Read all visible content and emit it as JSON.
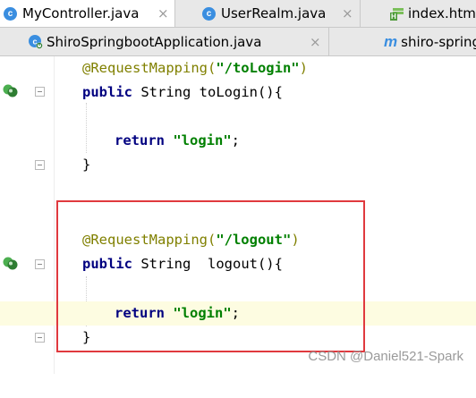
{
  "tabs_row1": [
    {
      "label": "MyController.java",
      "icon": "java-class-icon",
      "active": true,
      "closable": true
    },
    {
      "label": "UserRealm.java",
      "icon": "java-class-icon",
      "active": false,
      "closable": true
    },
    {
      "label": "index.html",
      "icon": "html-file-icon",
      "active": false,
      "closable": false
    }
  ],
  "tabs_row2": [
    {
      "label": "ShiroSpringbootApplication.java",
      "icon": "spring-boot-class-icon",
      "active": false,
      "closable": true
    },
    {
      "label": "shiro-springb",
      "icon": "maven-module-icon",
      "active": false,
      "closable": false
    }
  ],
  "icons": {
    "java_class_glyph": "c",
    "maven_glyph": "m",
    "html_badge": "H",
    "close_glyph": "×"
  },
  "editor": {
    "lines": {
      "l1": {
        "annotation": "@RequestMapping(",
        "string": "\"/toLogin\"",
        "close": ")"
      },
      "l2": {
        "kw": "public",
        "rest": " String toLogin(){"
      },
      "l3": {
        "kw": "return",
        "sp": " ",
        "string": "\"login\"",
        "end": ";"
      },
      "l4": {
        "text": "}"
      },
      "l5": {
        "annotation": "@RequestMapping(",
        "string": "\"/logout\"",
        "close": ")"
      },
      "l6": {
        "kw": "public",
        "rest": " String  logout(){"
      },
      "l7": {
        "kw": "return",
        "sp": " ",
        "string": "\"login\"",
        "end": ";"
      },
      "l8": {
        "text": "}"
      }
    }
  },
  "colors": {
    "annotation": "#808000",
    "keyword": "#000080",
    "string": "#008000",
    "highlight_box": "#e0393e",
    "current_line": "#fdfce1"
  },
  "watermark": "CSDN @Daniel521-Spark"
}
